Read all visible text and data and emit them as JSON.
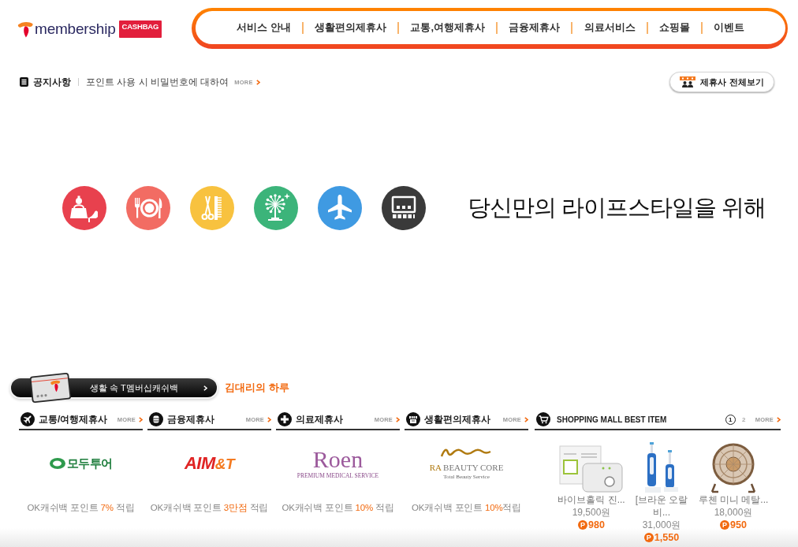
{
  "logo": {
    "wordmark": "membership",
    "badge": "CASHBAG"
  },
  "nav": {
    "items": [
      "서비스 안내",
      "생활편의제휴사",
      "교통,여행제휴사",
      "금융제휴사",
      "의료서비스",
      "쇼핑몰",
      "이벤트"
    ]
  },
  "notice": {
    "label": "공지사항",
    "text": "포인트 사용 시 비밀번호에 대하여",
    "more": "MORE"
  },
  "partners_button": {
    "label": "제휴사 전체보기"
  },
  "lifestyle": {
    "icons": [
      {
        "kind": "shopping",
        "color": "#e8414e"
      },
      {
        "kind": "dining",
        "color": "#f26c63"
      },
      {
        "kind": "beauty",
        "color": "#f8c23f"
      },
      {
        "kind": "leisure",
        "color": "#3cb47a"
      },
      {
        "kind": "travel",
        "color": "#3f9ae2"
      },
      {
        "kind": "culture",
        "color": "#3a3a3a"
      }
    ],
    "slogan": "당신만의 라이프스타일을 위해"
  },
  "banner": {
    "label": "생활 속 T멤버십캐쉬백",
    "story_link": "김대리의 하루"
  },
  "partner_sections": [
    {
      "kind": "travel",
      "title": "교통/여행제휴사",
      "more": "MORE",
      "logo": {
        "kind": "badge",
        "name": "모두투어"
      },
      "reward": {
        "before": "OK캐쉬백 포인트 ",
        "highlight": "7%",
        "after": " 적립"
      }
    },
    {
      "kind": "finance",
      "title": "금융제휴사",
      "more": "MORE",
      "logo": {
        "kind": "italic",
        "name": "AIM",
        "accent": "&T"
      },
      "reward": {
        "before": "OK캐쉬백 포인트 ",
        "highlight": "3만점",
        "after": " 적립"
      }
    },
    {
      "kind": "medical",
      "title": "의료제휴사",
      "more": "MORE",
      "logo": {
        "kind": "serif",
        "name": "Roen",
        "tagline": "PREMIUM MEDICAL SERVICE"
      },
      "reward": {
        "before": "OK캐쉬백 포인트 ",
        "highlight": "10%",
        "after": " 적립"
      }
    },
    {
      "kind": "living",
      "title": "생활편의제휴사",
      "more": "MORE",
      "logo": {
        "kind": "swash",
        "name": "RA",
        "accent": "BEAUTY CORE",
        "tagline": "Total Beauty Service"
      },
      "reward": {
        "before": "OK캐쉬백 포인트 ",
        "highlight": "10%",
        "after": "적립"
      }
    }
  ],
  "shopping": {
    "title": "SHOPPING MALL BEST ITEM",
    "pages": [
      {
        "label": "1",
        "selected": true
      },
      {
        "label": "2",
        "selected": false
      }
    ],
    "more": "MORE",
    "products": [
      {
        "kind": "device",
        "name": "바이브홀릭 진...",
        "price": "19,500원",
        "point_symbol": "P",
        "points": "980"
      },
      {
        "kind": "toothbrush",
        "name": "[브라운 오랄 비...",
        "price": "31,000원",
        "point_symbol": "P",
        "points": "1,550"
      },
      {
        "kind": "fan",
        "name": "루첸 미니 메탈...",
        "price": "18,000원",
        "point_symbol": "P",
        "points": "950"
      }
    ]
  }
}
